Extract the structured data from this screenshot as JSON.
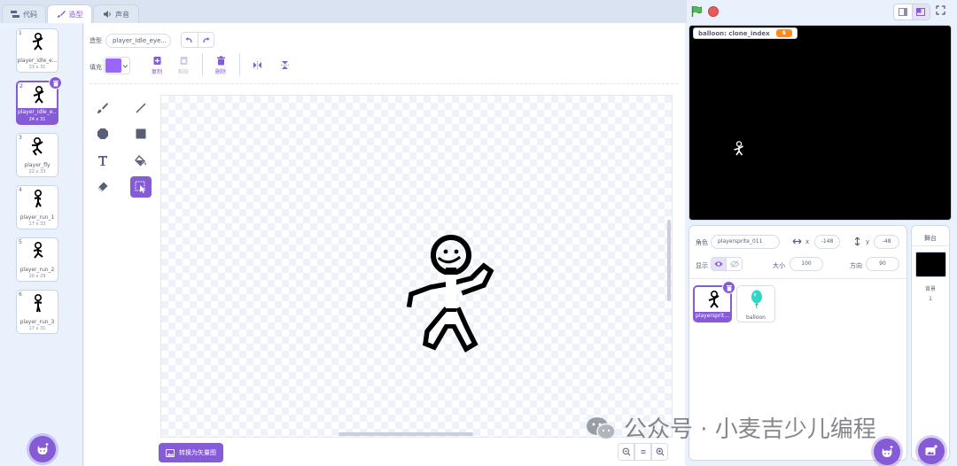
{
  "tabs": [
    {
      "label": "代码",
      "icon": "code-blocks-icon"
    },
    {
      "label": "造型",
      "icon": "brush-icon",
      "active": true
    },
    {
      "label": "声音",
      "icon": "speaker-icon"
    }
  ],
  "costumes": [
    {
      "num": "1",
      "name": "player_idle_e...",
      "size": "23 x 31"
    },
    {
      "num": "2",
      "name": "player_idle_e...",
      "size": "24 x 31",
      "selected": true
    },
    {
      "num": "3",
      "name": "player_fly",
      "size": "22 x 33"
    },
    {
      "num": "4",
      "name": "player_run_1",
      "size": "17 x 33"
    },
    {
      "num": "5",
      "name": "player_run_2",
      "size": "20 x 29"
    },
    {
      "num": "6",
      "name": "player_run_3",
      "size": "17 x 31"
    }
  ],
  "editor": {
    "costume_label": "造型",
    "costume_name": "player_idle_eye...",
    "fill_label": "填充",
    "fill_color": "#9966ff",
    "copy_label": "复制",
    "paste_label": "粘贴",
    "delete_label": "删除",
    "convert_label": "转换为矢量图"
  },
  "stage": {
    "monitor_label": "balloon: clone_index",
    "monitor_value": "6"
  },
  "sprite_info": {
    "sprite_label": "角色",
    "sprite_name": "playersprite_011",
    "x_label": "x",
    "x_value": "-148",
    "y_label": "y",
    "y_value": "-48",
    "show_label": "显示",
    "size_label": "大小",
    "size_value": "100",
    "direction_label": "方向",
    "direction_value": "90"
  },
  "sprites": [
    {
      "name": "playersprit...",
      "selected": true
    },
    {
      "name": "balloon"
    }
  ],
  "backdrop": {
    "title": "舞台",
    "backdrop_label": "背景",
    "count": "1"
  },
  "watermark": "公众号 · 小麦吉少儿编程",
  "colors": {
    "accent": "#855cd6",
    "monitor": "#ff8c1a",
    "balloon": "#2fd6c6"
  }
}
